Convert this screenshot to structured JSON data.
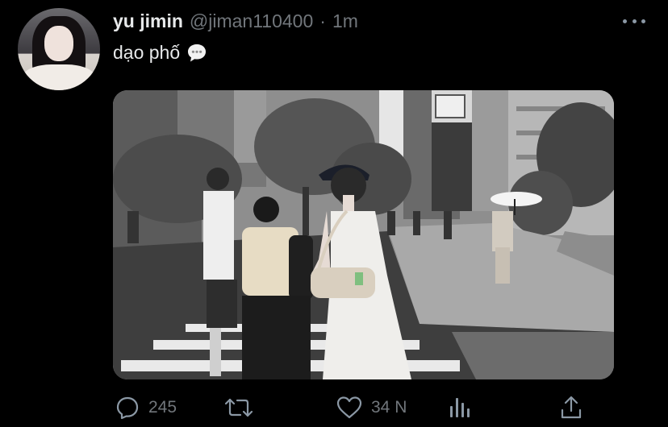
{
  "tweet": {
    "display_name": "yu jimin",
    "handle": "@jiman110400",
    "separator": "·",
    "time": "1m",
    "text": "dạo phố",
    "text_icon": "speech-bubble-icon"
  },
  "actions": {
    "reply_count": "245",
    "retweet_count": "",
    "like_count": "34 N",
    "icons": [
      "reply-icon",
      "retweet-icon",
      "like-icon",
      "analytics-icon",
      "share-icon"
    ]
  },
  "colors": {
    "background": "#000000",
    "text": "#e7e9ea",
    "muted": "#71767b"
  }
}
